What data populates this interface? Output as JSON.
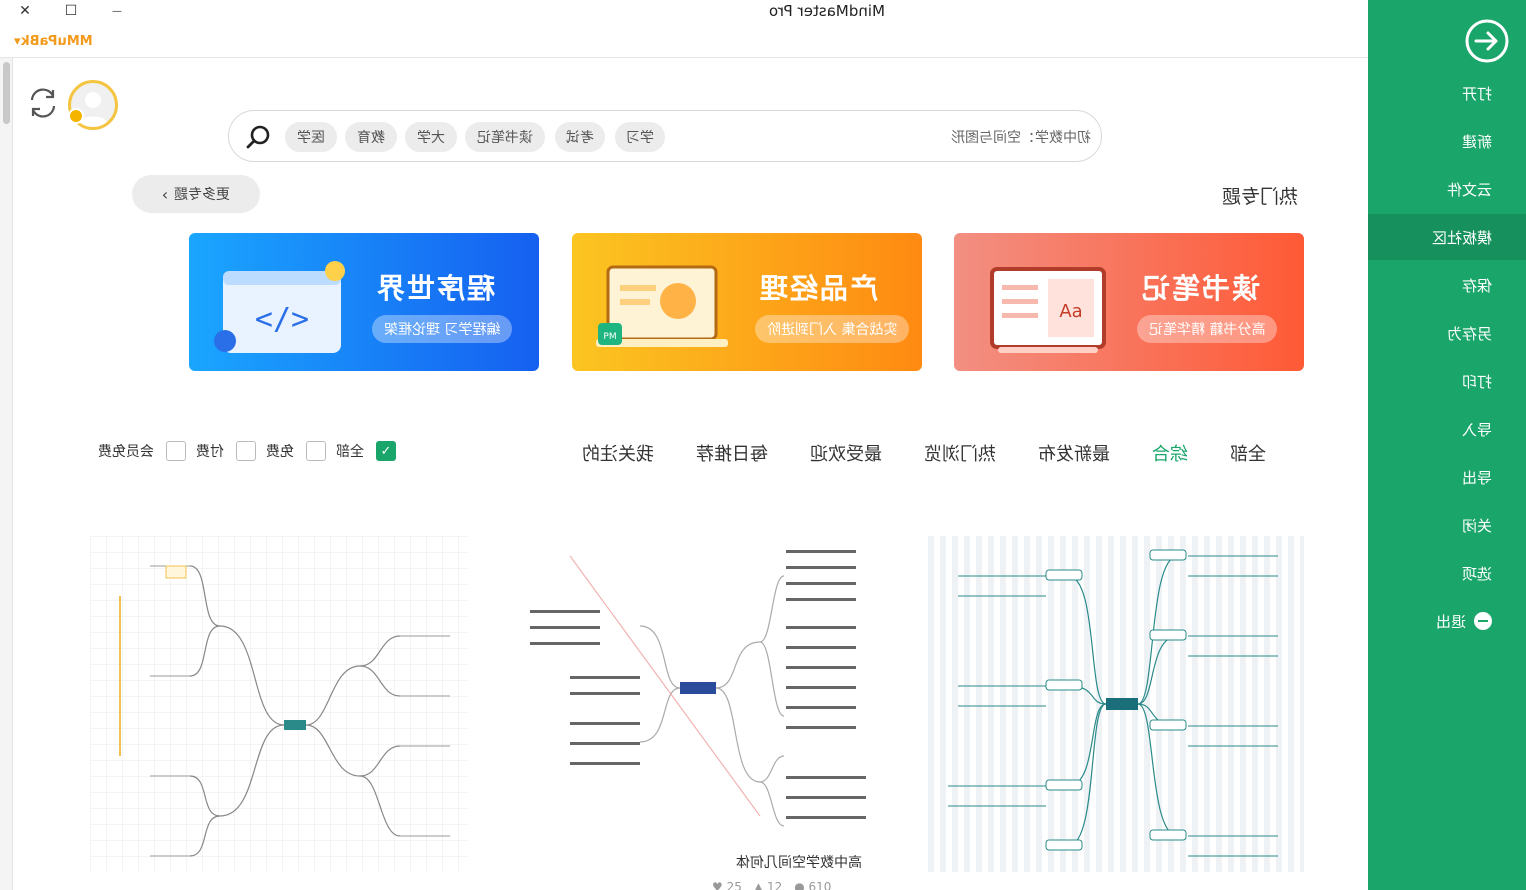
{
  "window": {
    "title": "MindMaster Pro",
    "close_glyph": "✕",
    "maximize_glyph": "☐",
    "minimize_glyph": "—",
    "user_name": "MMuPaBk"
  },
  "search": {
    "placeholder": "初中数学：空间与图形",
    "chips": [
      "学习",
      "考试",
      "读书笔记",
      "大学",
      "教育",
      "医学"
    ]
  },
  "topics": {
    "section_title": "热门专题",
    "more_label": "更多专题"
  },
  "banners": [
    {
      "title": "程序世界",
      "subtitle": "编程学习 理论框架"
    },
    {
      "title": "产品经理",
      "subtitle": "实战合集 入门到进阶"
    },
    {
      "title": "读书笔记",
      "subtitle": "高分书籍 精华笔记"
    }
  ],
  "tabs": [
    "全部",
    "综合",
    "最新发布",
    "热门浏览",
    "最受欢迎",
    "每日推荐",
    "我关注的"
  ],
  "active_tab": "综合",
  "filters": [
    {
      "label": "全部",
      "checked": true
    },
    {
      "label": "免费",
      "checked": false
    },
    {
      "label": "付费",
      "checked": false
    },
    {
      "label": "会员免费",
      "checked": false
    }
  ],
  "cards": [
    {
      "caption": "高中数学空间几何体",
      "views": "610",
      "likes": "12",
      "favorites": "25"
    }
  ],
  "sidebar": {
    "items": [
      "打开",
      "新建",
      "云文件",
      "模板社区",
      "保存",
      "另存为",
      "打印",
      "导入",
      "导出",
      "关闭",
      "选项"
    ],
    "active": "模板社区",
    "exit_label": "退出"
  }
}
